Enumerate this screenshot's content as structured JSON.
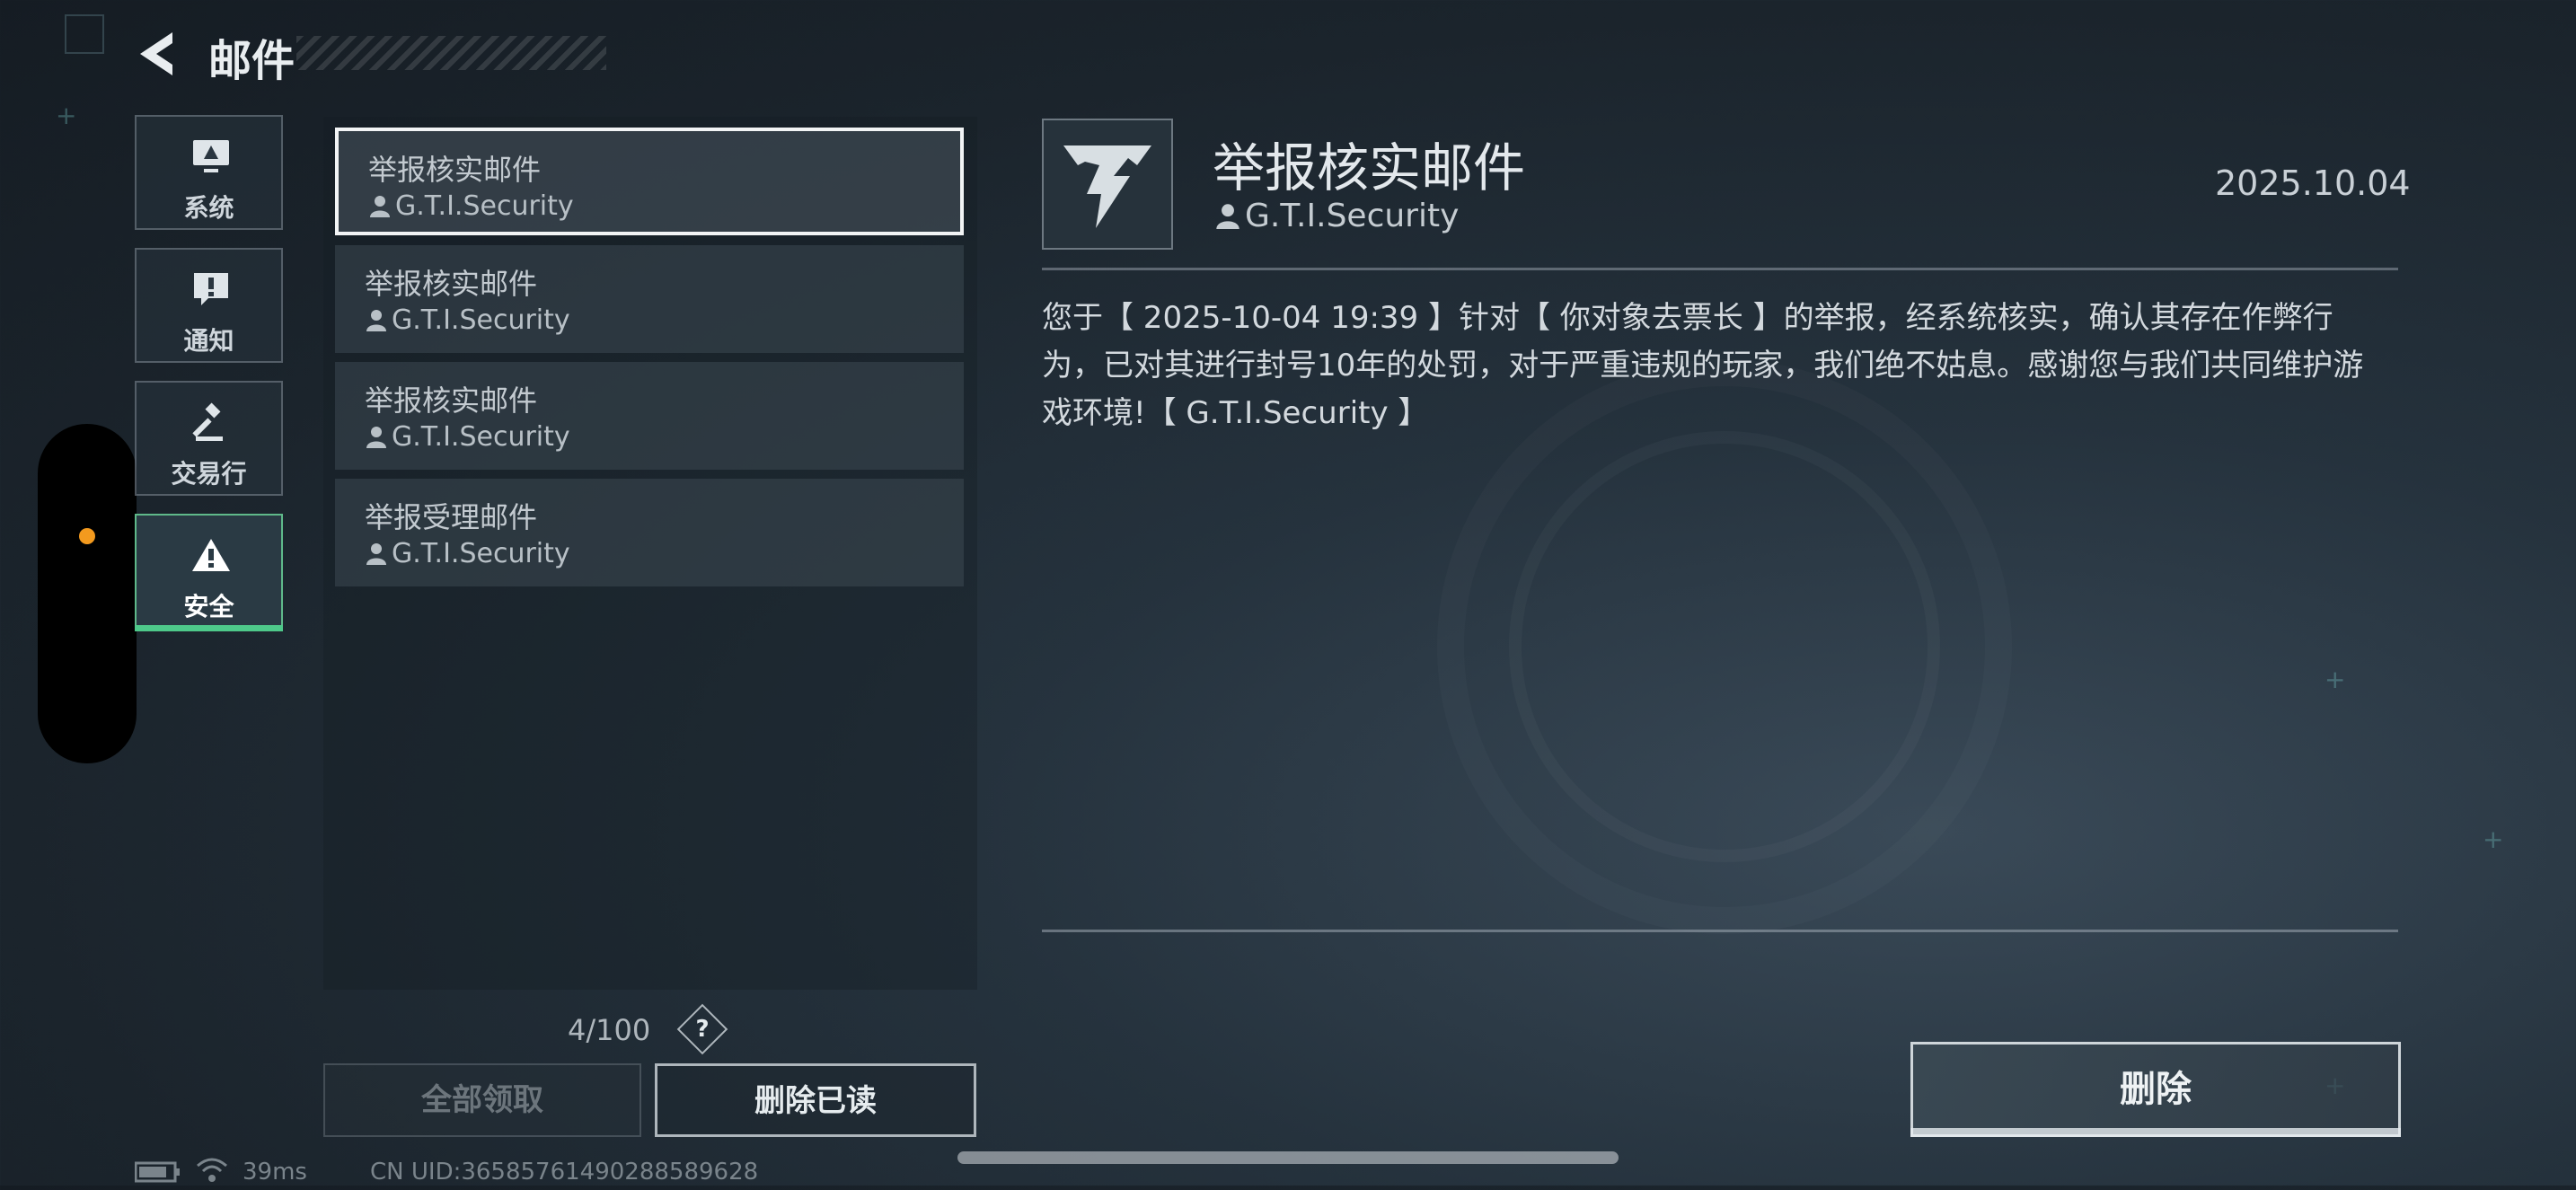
{
  "header": {
    "title": "邮件"
  },
  "categories": [
    {
      "label": "系统",
      "icon": "monitor-icon"
    },
    {
      "label": "通知",
      "icon": "exclamation-icon"
    },
    {
      "label": "交易行",
      "icon": "gavel-icon"
    },
    {
      "label": "安全",
      "icon": "warning-icon",
      "active": true
    }
  ],
  "mail_list": [
    {
      "subject": "举报核实邮件",
      "sender": "G.T.I.Security",
      "selected": true
    },
    {
      "subject": "举报核实邮件",
      "sender": "G.T.I.Security"
    },
    {
      "subject": "举报核实邮件",
      "sender": "G.T.I.Security"
    },
    {
      "subject": "举报受理邮件",
      "sender": "G.T.I.Security"
    }
  ],
  "mail_count": "4/100",
  "help_label": "?",
  "buttons": {
    "claim_all": "全部领取",
    "delete_read": "删除已读",
    "delete": "删除"
  },
  "detail": {
    "title": "举报核实邮件",
    "sender": "G.T.I.Security",
    "date": "2025.10.04",
    "body": "您于【 2025-10-04 19:39 】针对【 你对象去票长 】的举报，经系统核实，确认其存在作弊行为，已对其进行封号10年的处罚，对于严重违规的玩家，我们绝不姑息。感谢您与我们共同维护游戏环境!【 G.T.I.Security 】"
  },
  "status_bar": {
    "ping": "39ms",
    "uid": "CN UID:36585761490288589628"
  },
  "colors": {
    "accent": "#4ec98a",
    "notification_dot": "#f39a1e"
  }
}
